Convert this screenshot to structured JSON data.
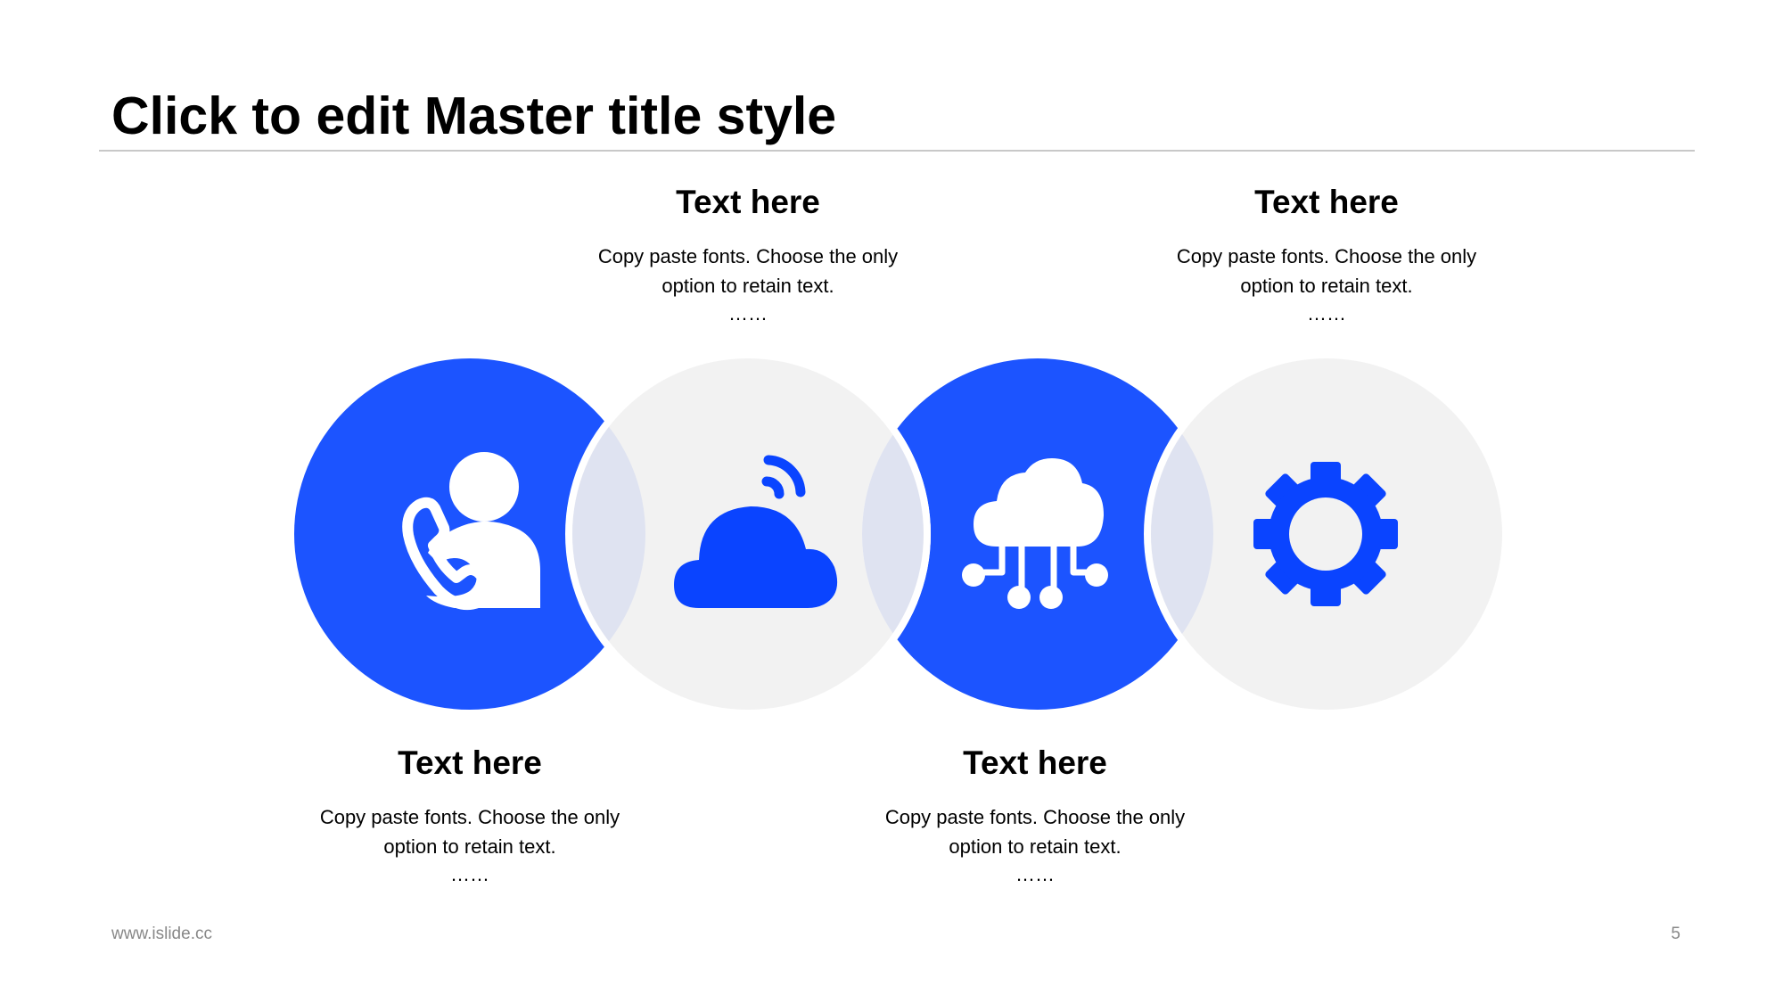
{
  "slide": {
    "title": "Click to edit Master title style",
    "footer_url": "www.islide.cc",
    "page_number": "5"
  },
  "items": [
    {
      "heading": "Text here",
      "body": "Copy paste fonts. Choose the only option to retain text.",
      "dots": "……",
      "icon": "phone-support-person-icon",
      "circle_style": "filled-blue"
    },
    {
      "heading": "Text here",
      "body": "Copy paste fonts. Choose the only option to retain text.",
      "dots": "……",
      "icon": "cloud-signal-icon",
      "circle_style": "light-gray"
    },
    {
      "heading": "Text here",
      "body": "Copy paste fonts. Choose the only option to retain text.",
      "dots": "……",
      "icon": "cloud-network-icon",
      "circle_style": "filled-blue"
    },
    {
      "heading": "Text here",
      "body": "Copy paste fonts. Choose the only option to retain text.",
      "dots": "……",
      "icon": "gear-icon",
      "circle_style": "light-gray"
    }
  ],
  "colors": {
    "accent_blue": "#1c54ff",
    "icon_blue": "#0a44ff",
    "light_gray": "#f2f2f2",
    "overlap_lavender": "#dfe3f1",
    "rule_gray": "#c8c8c8",
    "footer_gray": "#888888"
  }
}
